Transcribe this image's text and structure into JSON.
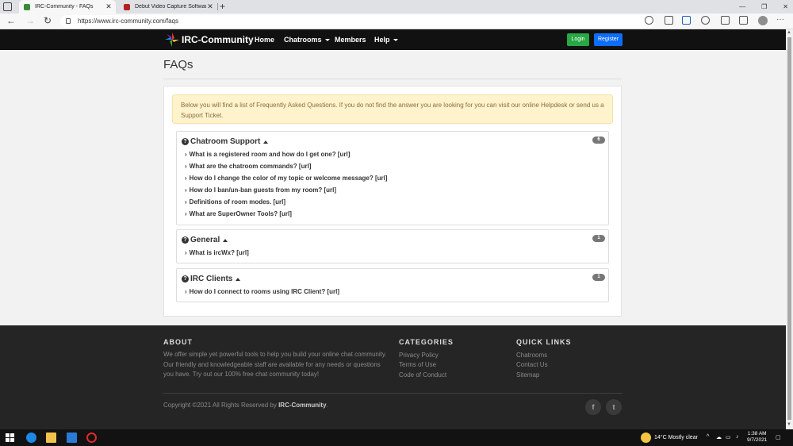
{
  "browser": {
    "tabs": [
      {
        "title": "IRC-Community - FAQs",
        "active": true
      },
      {
        "title": "Debut Video Capture Software S",
        "active": false
      }
    ],
    "url": "https://www.irc-community.com/faqs"
  },
  "nav": {
    "brand": "IRC-Community",
    "links": [
      "Home",
      "Chatrooms",
      "Members",
      "Help"
    ],
    "login": "Login",
    "register": "Register"
  },
  "page": {
    "title": "FAQs",
    "intro": "Below you will find a list of Frequently Asked Questions. If you do not find the answer you are looking for you can visit our online Helpdesk or send us a Support Ticket."
  },
  "sections": [
    {
      "title": "Chatroom Support",
      "count": "6",
      "items": [
        "What is a registered room and how do I get one? [url]",
        "What are the chatroom commands? [url]",
        "How do I change the color of my topic or welcome message? [url]",
        "How do I ban/un-ban guests from my room? [url]",
        "Definitions of room modes. [url]",
        "What are SuperOwner Tools? [url]"
      ]
    },
    {
      "title": "General",
      "count": "1",
      "items": [
        "What is ircWx? [url]"
      ]
    },
    {
      "title": "IRC Clients",
      "count": "1",
      "items": [
        "How do I connect to rooms using IRC Client? [url]"
      ]
    }
  ],
  "footer": {
    "about_head": "ABOUT",
    "about_text": "We offer simple yet powerful tools to help you build your online chat community. Our friendly and knowledgeable staff are available for any needs or questions you have. Try out our 100% free chat community today!",
    "categories_head": "CATEGORIES",
    "categories": [
      "Privacy Policy",
      "Terms of Use",
      "Code of Conduct"
    ],
    "quicklinks_head": "QUICK LINKS",
    "quicklinks": [
      "Chatrooms",
      "Contact Us",
      "Sitemap"
    ],
    "copyright_prefix": "Copyright ©2021 All Rights Reserved by ",
    "copyright_brand": "IRC-Community",
    "copyright_suffix": ".",
    "social": [
      "f",
      "t"
    ]
  },
  "taskbar": {
    "weather": "14°C  Mostly clear",
    "time": "1:38 AM",
    "date": "9/7/2021"
  }
}
